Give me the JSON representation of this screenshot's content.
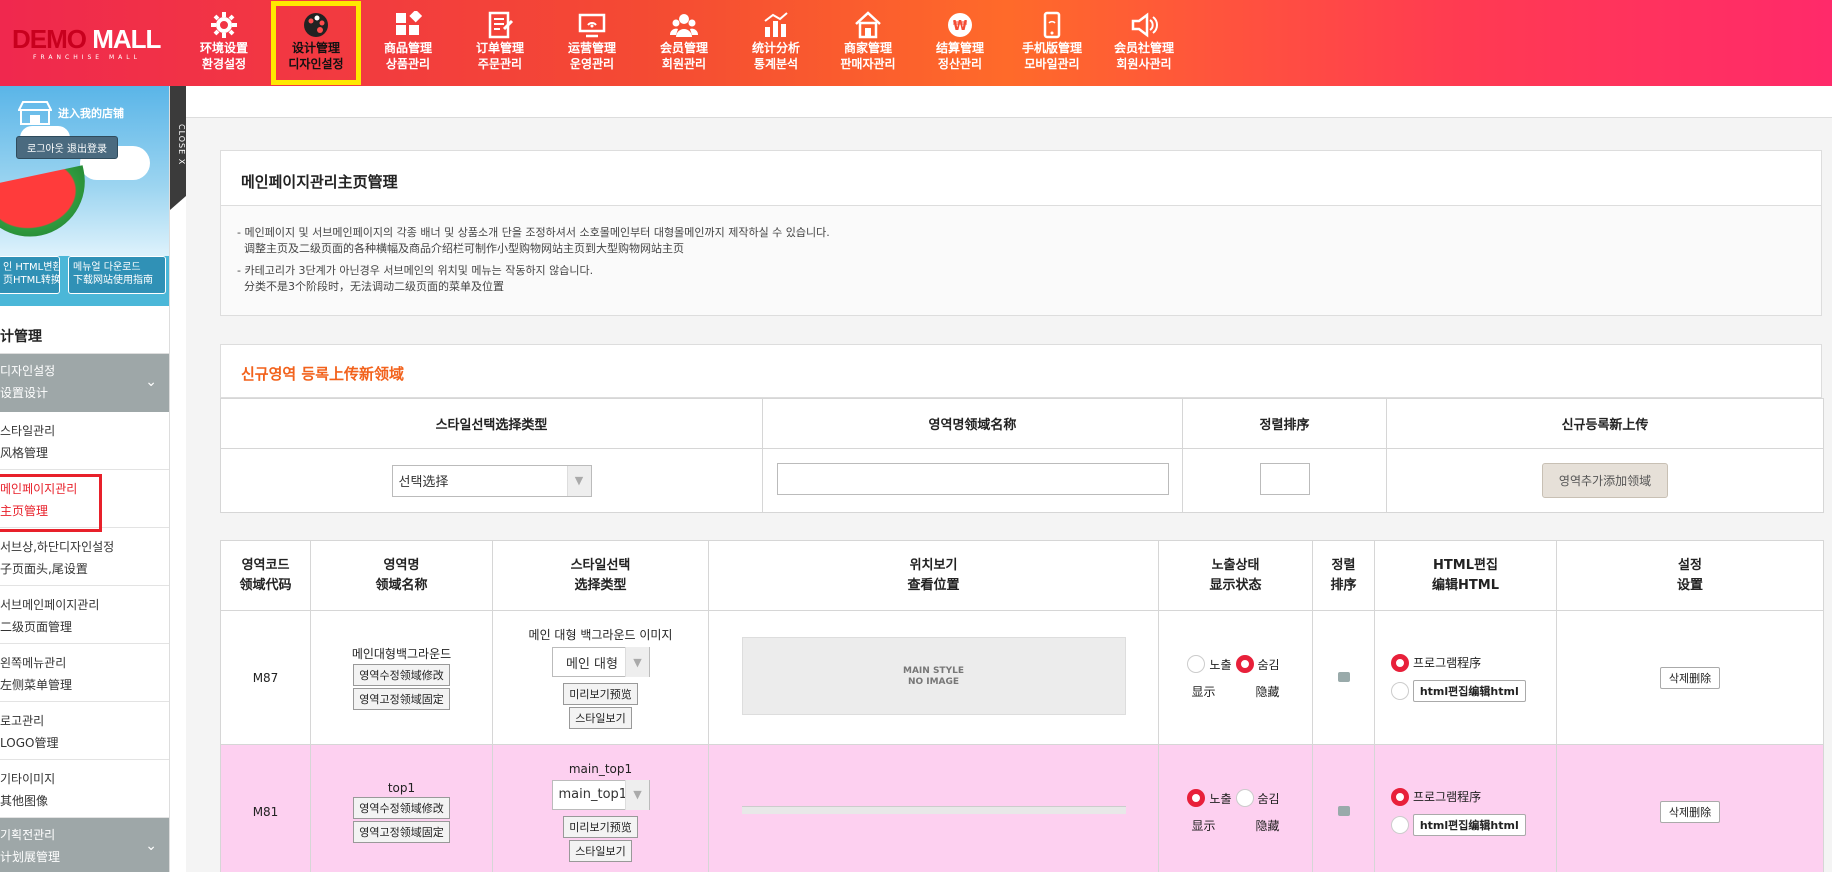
{
  "logo": {
    "main_red": "DEMO",
    "main_white": "MALL",
    "sub": "FRANCHISE MALL"
  },
  "nav": [
    {
      "l1": "环境设置",
      "l2": "환경설정",
      "icon": "gear-icon"
    },
    {
      "l1": "设计管理",
      "l2": "디자인설정",
      "icon": "palette-icon"
    },
    {
      "l1": "商品管理",
      "l2": "상품관리",
      "icon": "grid-icon"
    },
    {
      "l1": "订单管理",
      "l2": "주문관리",
      "icon": "order-icon"
    },
    {
      "l1": "运营管理",
      "l2": "운영관리",
      "icon": "monitor-icon"
    },
    {
      "l1": "会员管理",
      "l2": "회원관리",
      "icon": "users-icon"
    },
    {
      "l1": "统计分析",
      "l2": "통계분석",
      "icon": "chart-icon"
    },
    {
      "l1": "商家管理",
      "l2": "판매자관리",
      "icon": "house-icon"
    },
    {
      "l1": "结算管理",
      "l2": "정산관리",
      "icon": "won-icon"
    },
    {
      "l1": "手机版管理",
      "l2": "모바일관리",
      "icon": "mobile-icon"
    },
    {
      "l1": "会员社管理",
      "l2": "회원사관리",
      "icon": "speaker-icon"
    }
  ],
  "sidebar": {
    "shop_link": "进入我的店铺",
    "logout": "로그아웃 退出登录",
    "btn1": "인 HTML변환\n页HTML转换",
    "btn2": "메뉴얼 다운로드\n下载网站使用指南",
    "close": "CLOSE X",
    "title": "计管理",
    "group1": {
      "l1": "디자인설정",
      "l2": "设置设计"
    },
    "items": [
      {
        "l1": "스타일관리",
        "l2": "风格管理"
      },
      {
        "l1": "메인페이지관리",
        "l2": "主页管理"
      },
      {
        "l1": "서브상,하단디자인설정",
        "l2": "子页面头,尾设置"
      },
      {
        "l1": "서브메인페이지관리",
        "l2": "二级页面管理"
      },
      {
        "l1": "왼쪽메뉴관리",
        "l2": "左侧菜单管理"
      },
      {
        "l1": "로고관리",
        "l2": "LOGO管理"
      },
      {
        "l1": "기타이미지",
        "l2": "其他图像"
      }
    ],
    "group2": {
      "l1": "기획전관리",
      "l2": "计划展管理"
    }
  },
  "page": {
    "title": "메인페이지관리主页管理",
    "desc": [
      "- 메인페이지 및 서브메인페이지의 각종 배너 및 상품소개 단을 조정하셔서 소호몰메인부터 대형몰메인까지 제작하실 수 있습니다.",
      "  调整主页及二级页面的各种横幅及商品介绍栏可制作小型购物网站主页到大型购物网站主页",
      "- 카테고리가 3단계가 아닌경우 서브메인의 위치및 메뉴는 작동하지 않습니다.",
      "  分类不是3个阶段时，无法调动二级页面的菜单及位置"
    ],
    "new_section": "신규영역 등록上传新领域"
  },
  "new_table": {
    "headers": [
      "스타일선택选择类型",
      "영역명领域名称",
      "정렬排序",
      "신규등록新上传"
    ],
    "select_value": "선택选择",
    "add_button": "영역추가添加领域"
  },
  "list_table": {
    "headers": [
      {
        "l1": "영역코드",
        "l2": "领域代码"
      },
      {
        "l1": "영역명",
        "l2": "领域名称"
      },
      {
        "l1": "스타일선택",
        "l2": "选择类型"
      },
      {
        "l1": "위치보기",
        "l2": "查看位置"
      },
      {
        "l1": "노출상태",
        "l2": "显示状态"
      },
      {
        "l1": "정렬",
        "l2": "排序"
      },
      {
        "l1": "HTML편집",
        "l2": "编辑HTML"
      },
      {
        "l1": "설정",
        "l2": "设置"
      }
    ],
    "rows": [
      {
        "code": "M87",
        "name": "메인대형백그라운드",
        "edit_btn": "영역수정领域修改",
        "fix_btn": "영역고정领域固定",
        "style_label": "메인 대형 백그라운드 이미지",
        "style_select": "메인 대형",
        "preview_btn": "미리보기预览",
        "style_btn": "스타일보기",
        "thumb_text": "MAIN STYLE\nNO IMAGE",
        "show_label": "노출",
        "hide_label": "숨김",
        "show_sub": "显示",
        "hide_sub": "隐藏",
        "shown": false,
        "prog_label": "프로그램程序",
        "html_btn": "html편집编辑html",
        "del_btn": "삭제删除"
      },
      {
        "code": "M81",
        "name": "top1",
        "edit_btn": "영역수정领域修改",
        "fix_btn": "영역고정领域固定",
        "style_label": "main_top1",
        "style_select": "main_top1",
        "preview_btn": "미리보기预览",
        "style_btn": "스타일보기",
        "thumb_text": "",
        "show_label": "노출",
        "hide_label": "숨김",
        "show_sub": "显示",
        "hide_sub": "隐藏",
        "shown": true,
        "prog_label": "프로그램程序",
        "html_btn": "html편집编辑html",
        "del_btn": "삭제删除"
      }
    ]
  },
  "colors": {
    "accent": "#f2621c",
    "radio_on": "#e8203a",
    "row_highlight": "#fdd0f0",
    "nav_active_outline": "#ffe800"
  }
}
